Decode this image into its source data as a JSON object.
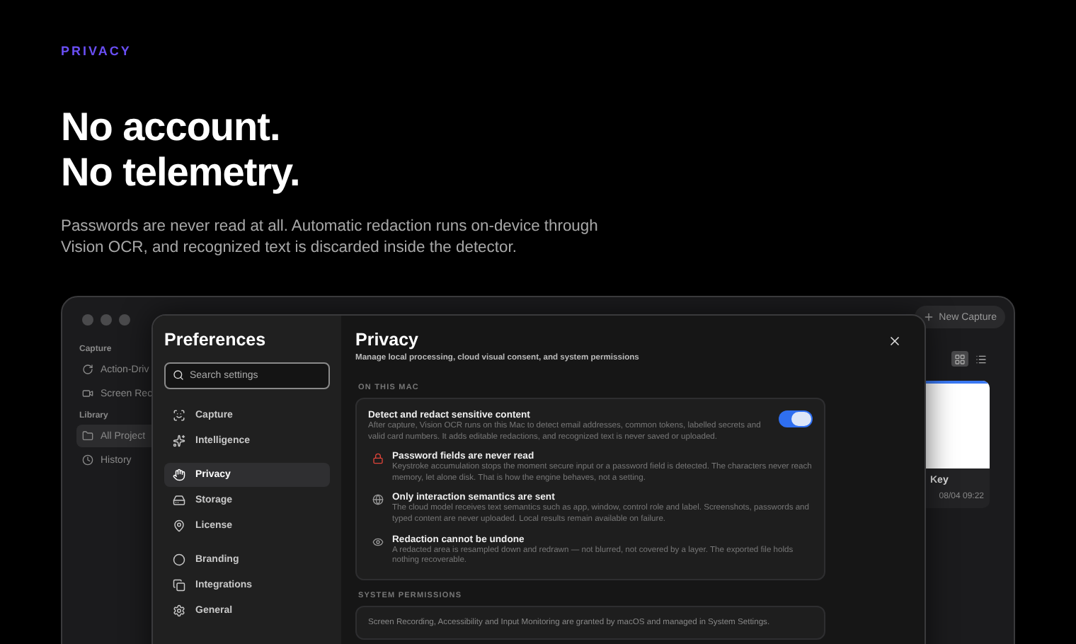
{
  "hero": {
    "eyebrow": "PRIVACY",
    "headline": [
      "No account.",
      "No telemetry."
    ],
    "body": "Passwords are never read at all. Automatic redaction runs on-device through Vision OCR, and recognized text is discarded inside the detector."
  },
  "app": {
    "sidebar": [
      {
        "title": "Capture",
        "items": [
          {
            "label": "Action-Driv",
            "selected": false
          },
          {
            "label": "Screen Rec",
            "selected": false
          }
        ]
      },
      {
        "title": "Library",
        "items": [
          {
            "label": "All Project",
            "selected": true
          },
          {
            "label": "History",
            "selected": false
          }
        ]
      }
    ],
    "new_button": "New Capture",
    "view_modes": [
      {
        "kind": "grid",
        "selected": true
      },
      {
        "kind": "list",
        "selected": false
      }
    ],
    "card": {
      "title": "Key",
      "time": "08/04 09:22"
    }
  },
  "preferences": {
    "title": "Preferences",
    "search": {
      "placeholder": "Search settings"
    },
    "nav": [
      [
        {
          "label": "Capture",
          "selected": false
        },
        {
          "label": "Intelligence",
          "selected": false
        }
      ],
      [
        {
          "label": "Privacy",
          "selected": true
        },
        {
          "label": "Storage",
          "selected": false
        },
        {
          "label": "License",
          "selected": false
        }
      ],
      [
        {
          "label": "Branding",
          "selected": false
        },
        {
          "label": "Integrations",
          "selected": false
        },
        {
          "label": "General",
          "selected": false
        }
      ]
    ],
    "page": {
      "title": "Privacy",
      "subtitle": "Manage local processing, cloud visual consent, and system permissions",
      "sections": [
        {
          "heading": "ON THIS MAC",
          "toggle": {
            "title": "Detect and redact sensitive content",
            "description": "After capture, Vision OCR runs on this Mac to detect email addresses, common tokens, labelled secrets and valid card numbers. It adds editable redactions, and recognized text is never saved or uploaded.",
            "on": true
          },
          "facts": [
            {
              "title": "Password fields are never read",
              "description": "Keystroke accumulation stops the moment secure input or a password field is detected. The characters never reach memory, let alone disk. That is how the engine behaves, not a setting."
            },
            {
              "title": "Only interaction semantics are sent",
              "description": "The cloud model receives text semantics such as app, window, control role and label. Screenshots, passwords and typed content are never uploaded. Local results remain available on failure."
            },
            {
              "title": "Redaction cannot be undone",
              "description": "A redacted area is resampled down and redrawn — not blurred, not covered by a layer. The exported file holds nothing recoverable."
            }
          ]
        },
        {
          "heading": "SYSTEM PERMISSIONS",
          "note": "Screen Recording, Accessibility and Input Monitoring are granted by macOS and managed in System Settings."
        }
      ]
    }
  }
}
